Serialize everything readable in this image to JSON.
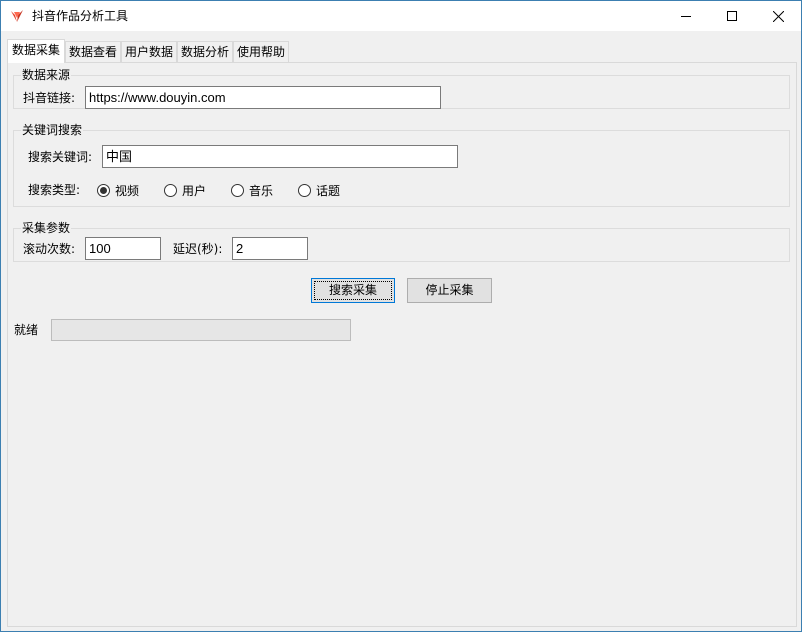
{
  "window": {
    "title": "抖音作品分析工具",
    "app_icon": "douyin-app-icon"
  },
  "tabs": [
    {
      "label": "数据采集",
      "active": true
    },
    {
      "label": "数据查看",
      "active": false
    },
    {
      "label": "用户数据",
      "active": false
    },
    {
      "label": "数据分析",
      "active": false
    },
    {
      "label": "使用帮助",
      "active": false
    }
  ],
  "data_source": {
    "group_title": "数据来源",
    "link_label": "抖音链接:",
    "link_value": "https://www.douyin.com"
  },
  "keyword_search": {
    "group_title": "关键词搜索",
    "keyword_label": "搜索关键词:",
    "keyword_value": "中国",
    "type_label": "搜索类型:",
    "types": [
      {
        "label": "视频",
        "checked": true
      },
      {
        "label": "用户",
        "checked": false
      },
      {
        "label": "音乐",
        "checked": false
      },
      {
        "label": "话题",
        "checked": false
      }
    ]
  },
  "params": {
    "group_title": "采集参数",
    "scroll_label": "滚动次数:",
    "scroll_value": "100",
    "delay_label": "延迟(秒):",
    "delay_value": "2"
  },
  "actions": {
    "search_label": "搜索采集",
    "stop_label": "停止采集"
  },
  "status": {
    "text": "就绪",
    "progress": 0
  },
  "colors": {
    "window_border": "#3c7fb1",
    "background": "#f0f0f0",
    "focus_accent": "#0078d7",
    "icon_red": "#e8402a"
  }
}
